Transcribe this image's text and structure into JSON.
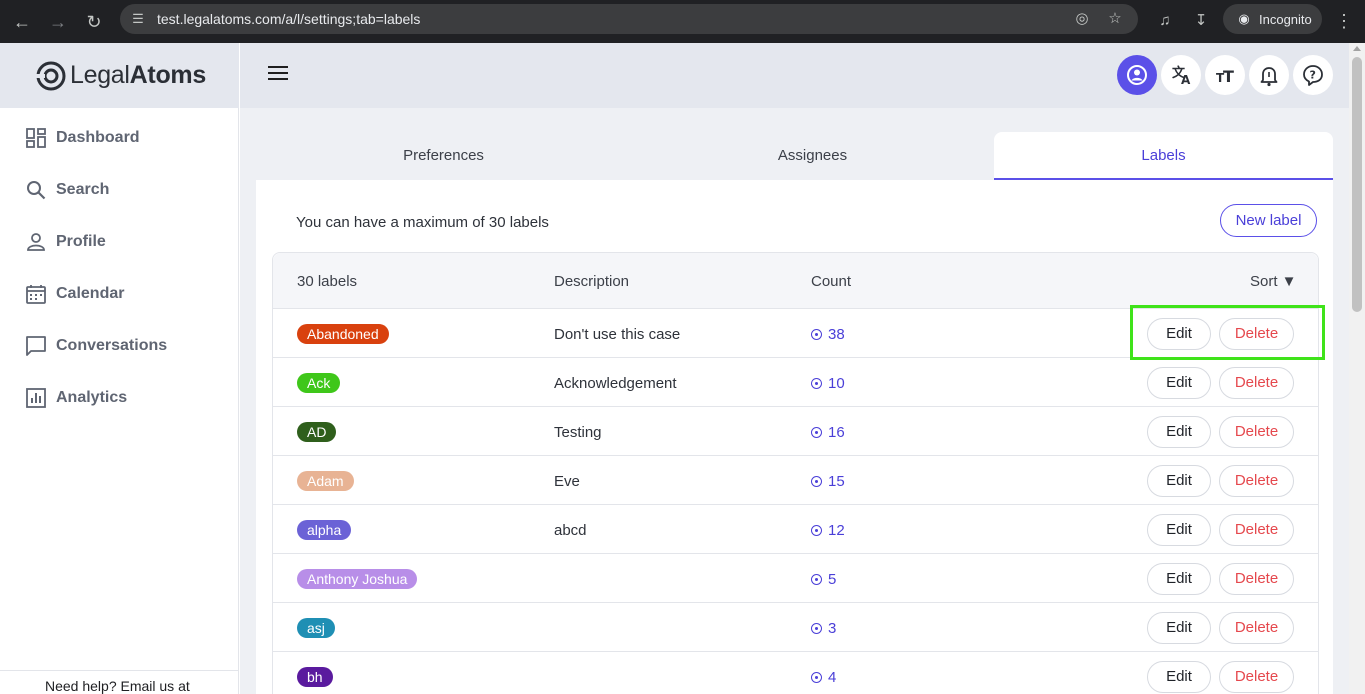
{
  "browser": {
    "url": "test.legalatoms.com/a/l/settings;tab=labels",
    "incognito_label": "Incognito",
    "icons": [
      "back-icon",
      "forward-icon",
      "reload-icon",
      "site-settings-icon",
      "eye-off-icon",
      "star-icon",
      "media-control-icon",
      "download-icon",
      "incognito-icon",
      "kebab-menu-icon"
    ]
  },
  "brand": {
    "name_light": "Legal",
    "name_bold": "Atoms"
  },
  "sidebar": {
    "items": [
      {
        "label": "Dashboard",
        "icon": "dashboard-icon"
      },
      {
        "label": "Search",
        "icon": "search-icon"
      },
      {
        "label": "Profile",
        "icon": "profile-icon"
      },
      {
        "label": "Calendar",
        "icon": "calendar-icon"
      },
      {
        "label": "Conversations",
        "icon": "conversations-icon"
      },
      {
        "label": "Analytics",
        "icon": "analytics-icon"
      }
    ],
    "footer_text": "Need help? Email us at"
  },
  "header": {
    "buttons": [
      {
        "icon": "account-icon",
        "active": true
      },
      {
        "icon": "translate-icon",
        "active": false
      },
      {
        "icon": "text-size-icon",
        "active": false
      },
      {
        "icon": "notifications-icon",
        "active": false
      },
      {
        "icon": "help-icon",
        "active": false
      }
    ]
  },
  "tabs": [
    {
      "label": "Preferences",
      "active": false
    },
    {
      "label": "Assignees",
      "active": false
    },
    {
      "label": "Labels",
      "active": true
    }
  ],
  "labels_panel": {
    "info_text": "You can have a maximum of 30 labels",
    "new_label_button": "New label",
    "columns": {
      "name": "30 labels",
      "description": "Description",
      "count": "Count",
      "sort": "Sort ▼"
    },
    "edit_label": "Edit",
    "delete_label": "Delete",
    "rows": [
      {
        "name": "Abandoned",
        "color": "#d9410e",
        "description": "Don't use this case",
        "count": "38"
      },
      {
        "name": "Ack",
        "color": "#3fc71a",
        "description": "Acknowledgement",
        "count": "10"
      },
      {
        "name": "AD",
        "color": "#2f5f1c",
        "description": "Testing",
        "count": "16"
      },
      {
        "name": "Adam",
        "color": "#e8b394",
        "description": "Eve",
        "count": "15"
      },
      {
        "name": "alpha",
        "color": "#6b62d6",
        "description": "abcd",
        "count": "12"
      },
      {
        "name": "Anthony Joshua",
        "color": "#b88ee8",
        "description": "",
        "count": "5"
      },
      {
        "name": "asj",
        "color": "#1f8fb4",
        "description": "",
        "count": "3"
      },
      {
        "name": "bh",
        "color": "#5a1a9e",
        "description": "",
        "count": "4"
      }
    ]
  },
  "accent_color": "#5b50e8",
  "highlight_color": "#3fe31a"
}
